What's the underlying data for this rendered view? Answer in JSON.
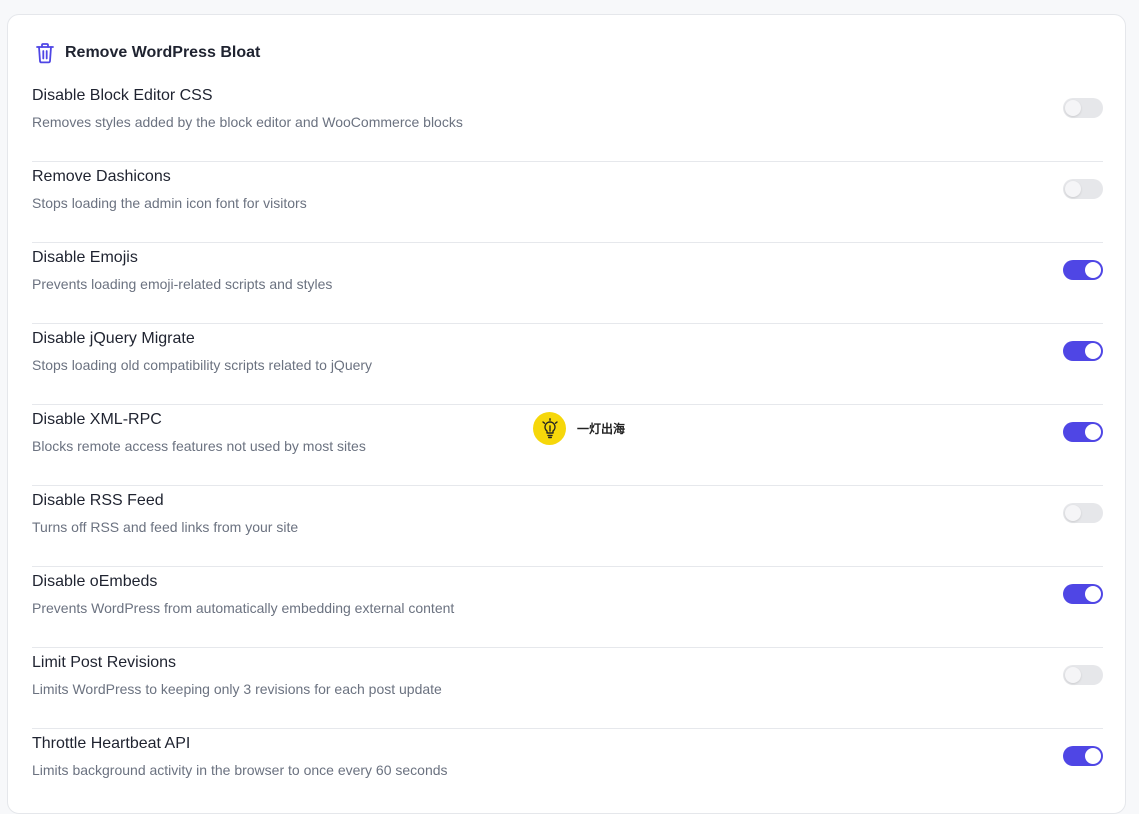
{
  "section": {
    "title": "Remove WordPress Bloat",
    "icon": "trash-icon",
    "accent_color": "#4f46e5"
  },
  "settings": [
    {
      "label": "Disable Block Editor CSS",
      "description": "Removes styles added by the block editor and WooCommerce blocks",
      "enabled": false
    },
    {
      "label": "Remove Dashicons",
      "description": "Stops loading the admin icon font for visitors",
      "enabled": false
    },
    {
      "label": "Disable Emojis",
      "description": "Prevents loading emoji-related scripts and styles",
      "enabled": true
    },
    {
      "label": "Disable jQuery Migrate",
      "description": "Stops loading old compatibility scripts related to jQuery",
      "enabled": true
    },
    {
      "label": "Disable XML-RPC",
      "description": "Blocks remote access features not used by most sites",
      "enabled": true
    },
    {
      "label": "Disable RSS Feed",
      "description": "Turns off RSS and feed links from your site",
      "enabled": false
    },
    {
      "label": "Disable oEmbeds",
      "description": "Prevents WordPress from automatically embedding external content",
      "enabled": true
    },
    {
      "label": "Limit Post Revisions",
      "description": "Limits WordPress to keeping only 3 revisions for each post update",
      "enabled": false
    },
    {
      "label": "Throttle Heartbeat API",
      "description": "Limits background activity in the browser to once every 60 seconds",
      "enabled": true
    }
  ],
  "watermark": {
    "text": "一灯出海",
    "icon": "lightbulb-icon"
  }
}
